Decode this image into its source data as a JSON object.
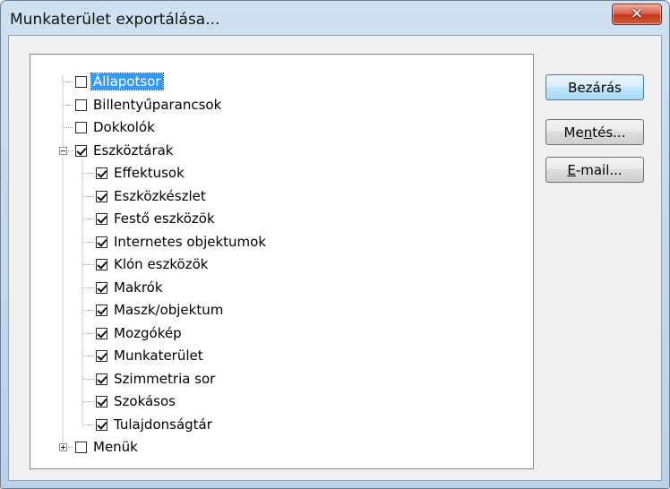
{
  "window": {
    "title": "Munkaterület exportálása..."
  },
  "tree": {
    "items": [
      {
        "label": "Állapotsor",
        "checked": false,
        "level": 0,
        "selected": true
      },
      {
        "label": "Billentyűparancsok",
        "checked": false,
        "level": 0
      },
      {
        "label": "Dokkolók",
        "checked": false,
        "level": 0
      },
      {
        "label": "Eszköztárak",
        "checked": true,
        "level": 0,
        "expander": "minus"
      },
      {
        "label": "Effektusok",
        "checked": true,
        "level": 1
      },
      {
        "label": "Eszközkészlet",
        "checked": true,
        "level": 1
      },
      {
        "label": "Festő eszközök",
        "checked": true,
        "level": 1
      },
      {
        "label": "Internetes objektumok",
        "checked": true,
        "level": 1
      },
      {
        "label": "Klón eszközök",
        "checked": true,
        "level": 1
      },
      {
        "label": "Makrók",
        "checked": true,
        "level": 1
      },
      {
        "label": "Maszk/objektum",
        "checked": true,
        "level": 1
      },
      {
        "label": "Mozgókép",
        "checked": true,
        "level": 1
      },
      {
        "label": "Munkaterület",
        "checked": true,
        "level": 1
      },
      {
        "label": "Szimmetria sor",
        "checked": true,
        "level": 1
      },
      {
        "label": "Szokásos",
        "checked": true,
        "level": 1
      },
      {
        "label": "Tulajdonságtár",
        "checked": true,
        "level": 1
      },
      {
        "label": "Menük",
        "checked": false,
        "level": 0,
        "expander": "plus"
      }
    ]
  },
  "buttons": {
    "close": {
      "label": "Bezárás"
    },
    "save": {
      "pre": "Me",
      "accel": "n",
      "post": "tés..."
    },
    "email": {
      "pre": "",
      "accel": "E",
      "post": "-mail..."
    }
  },
  "colors": {
    "selection": "#3399ff",
    "close_button": "#c2351b"
  }
}
